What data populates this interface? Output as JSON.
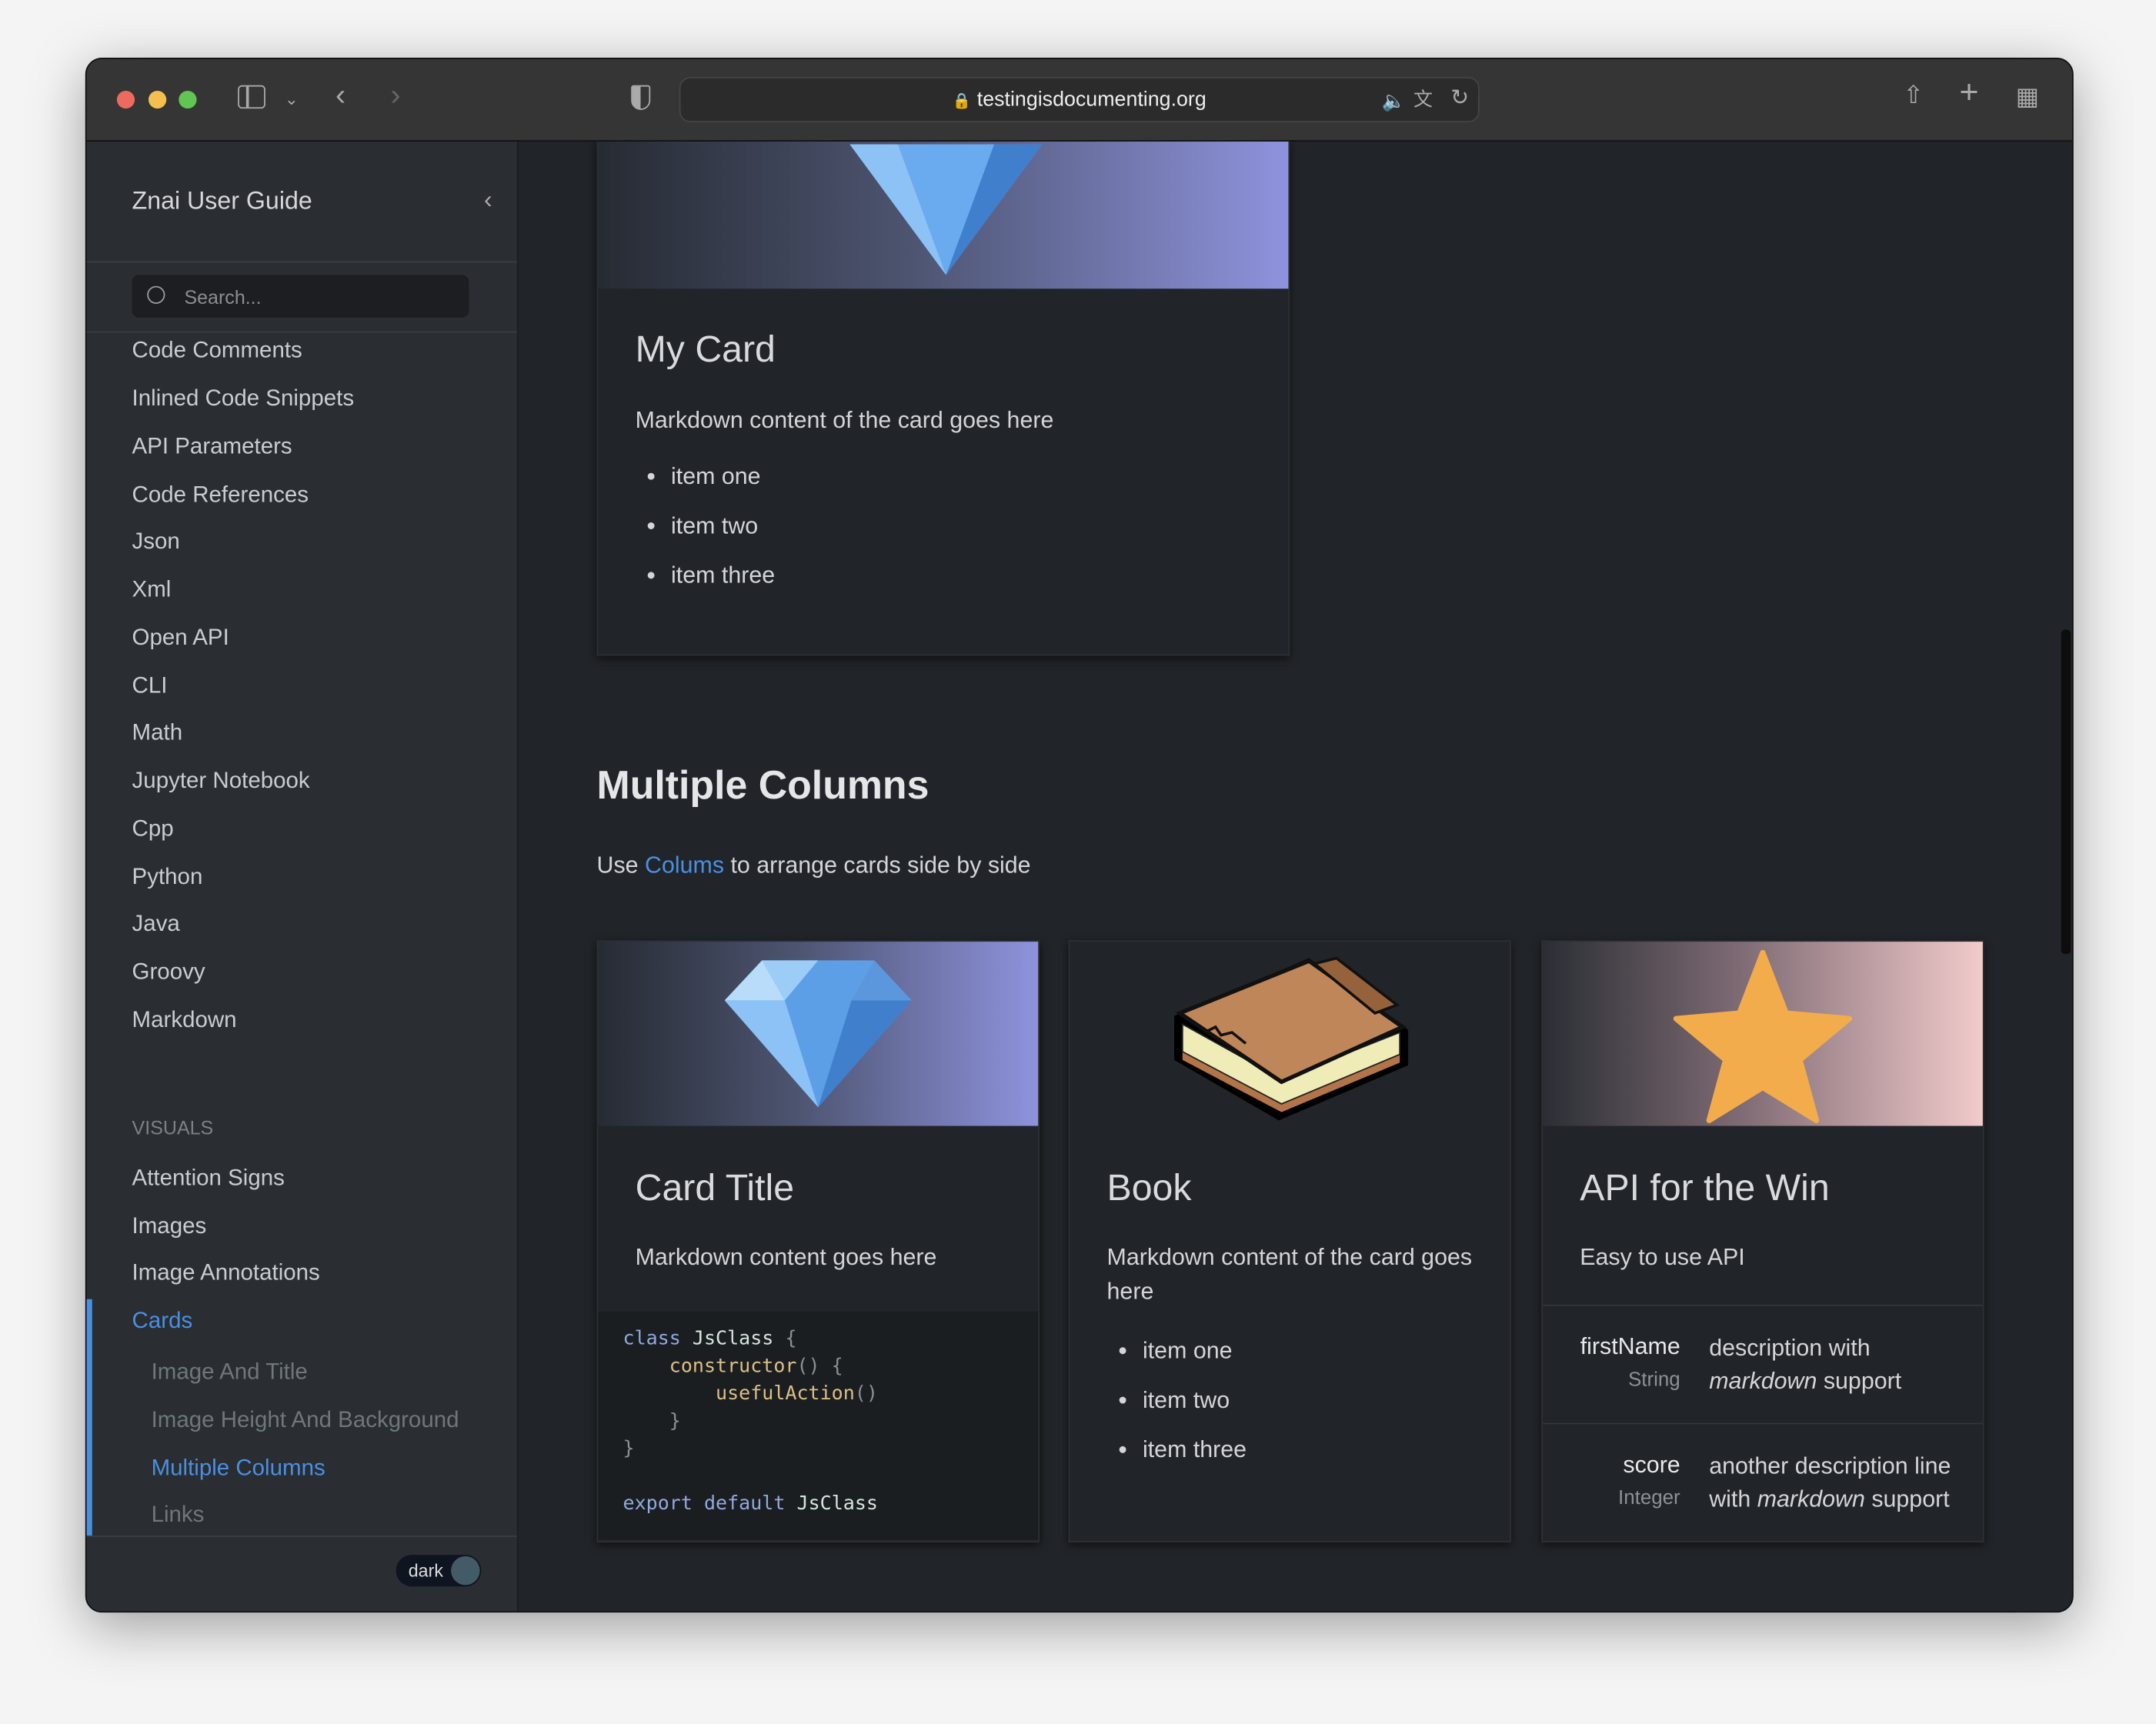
{
  "browser": {
    "url": "testingisdocumenting.org",
    "traffic_lights": {
      "close": "#ed6a5e",
      "minimize": "#f5bf4f",
      "maximize": "#61c554"
    },
    "icons": [
      "sidebar-icon",
      "chevron-down-icon",
      "back-icon",
      "forward-icon",
      "shield-icon",
      "lock-icon",
      "speaker-icon",
      "translate-icon",
      "reload-icon",
      "share-icon",
      "new-tab-icon",
      "tab-overview-icon"
    ]
  },
  "sidebar": {
    "title": "Znai User Guide",
    "search_placeholder": "Search...",
    "items": [
      "Code Comments",
      "Inlined Code Snippets",
      "API Parameters",
      "Code References",
      "Json",
      "Xml",
      "Open API",
      "CLI",
      "Math",
      "Jupyter Notebook",
      "Cpp",
      "Python",
      "Java",
      "Groovy",
      "Markdown"
    ],
    "section": "VISUALS",
    "visual_items": [
      "Attention Signs",
      "Images",
      "Image Annotations",
      "Cards"
    ],
    "sub_items": [
      "Image And Title",
      "Image Height And Background",
      "Multiple Columns",
      "Links"
    ],
    "active_item": "Cards",
    "active_sub_item": "Multiple Columns",
    "theme_toggle": "dark",
    "accent": "#4a90e2"
  },
  "main": {
    "top_card": {
      "title": "My Card",
      "text": "Markdown content of the card goes here",
      "items": [
        "item one",
        "item two",
        "item three"
      ]
    },
    "section_title": "Multiple Columns",
    "intro_before": "Use",
    "intro_link": "Colums",
    "intro_after": "to arrange cards side by side",
    "cards": [
      {
        "title": "Card Title",
        "text": "Markdown content goes here",
        "code": {
          "l1_kw": "class",
          "l1_name": "JsClass",
          "l1_brace": "{",
          "l2_fn": "constructor",
          "l2_rest": "() {",
          "l3_fn": "usefulAction",
          "l3_rest": "()",
          "l4": "}",
          "l5": "}",
          "l7_kw1": "export",
          "l7_kw2": "default",
          "l7_name": "JsClass"
        }
      },
      {
        "title": "Book",
        "text": "Markdown content of the card goes here",
        "items": [
          "item one",
          "item two",
          "item three"
        ]
      },
      {
        "title": "API for the Win",
        "text": "Easy to use API",
        "params": [
          {
            "name": "firstName",
            "type": "String",
            "desc_pre": "description with",
            "desc_em": "markdown",
            "desc_post": "support"
          },
          {
            "name": "score",
            "type": "Integer",
            "desc_pre": "another description line with",
            "desc_em": "markdown",
            "desc_post": "support"
          }
        ]
      }
    ]
  }
}
